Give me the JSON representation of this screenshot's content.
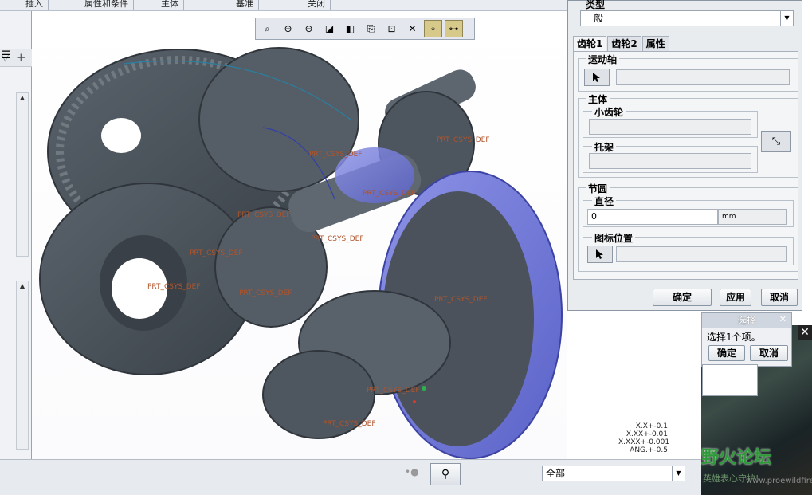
{
  "ribbon": {
    "tabs": [
      "插入",
      "属性和条件",
      "主体",
      "基准",
      "关闭"
    ]
  },
  "viewtoolbar": {
    "icons": [
      "zoom-window-icon",
      "zoom-in-icon",
      "zoom-out-icon",
      "refit-icon",
      "display-style-icon",
      "saved-views-icon",
      "perspective-icon",
      "datum-display-icon",
      "spin-center-icon",
      "annotation-display-icon"
    ]
  },
  "model": {
    "csys_labels": [
      "PRT_CSYS_DEF",
      "PRT_CSYS_DEF",
      "PRT_CSYS_DEF",
      "PRT_CSYS_DEF",
      "PRT_CSYS_DEF",
      "PRT_CSYS_DEF",
      "PRT_CSYS_DEF",
      "PRT_CSYS_DEF",
      "PRT_CSYS_DEF",
      "PRT_CSYS_DEF",
      "PRT_CSYS_DEF"
    ],
    "accent_blue": "#6f78d8",
    "body_gray": "#4e565f"
  },
  "dialog": {
    "type_label": "类型",
    "type_value": "一般",
    "tabs": [
      "齿轮1",
      "齿轮2",
      "属性"
    ],
    "motion_axis_label": "运动轴",
    "body_label": "主体",
    "pinion_label": "小齿轮",
    "carrier_label": "托架",
    "pitch_circle_label": "节圆",
    "diameter_label": "直径",
    "diameter_value": "0",
    "diameter_unit": "mm",
    "icon_position_label": "图标位置",
    "ok": "确定",
    "apply": "应用",
    "cancel": "取消"
  },
  "select_dialog": {
    "title": "选择",
    "message": "选择1个项。",
    "ok": "确定",
    "cancel": "取消"
  },
  "tolerances": [
    "X.X+-0.1",
    "X.XX+-0.01",
    "X.XXX+-0.001",
    "ANG.+-0.5"
  ],
  "statusbar": {
    "filter_value": "全部"
  },
  "watermark": {
    "title": "野火论坛",
    "subtitle": "英雄表心守护!",
    "url": "www.proewildfire.cn"
  }
}
